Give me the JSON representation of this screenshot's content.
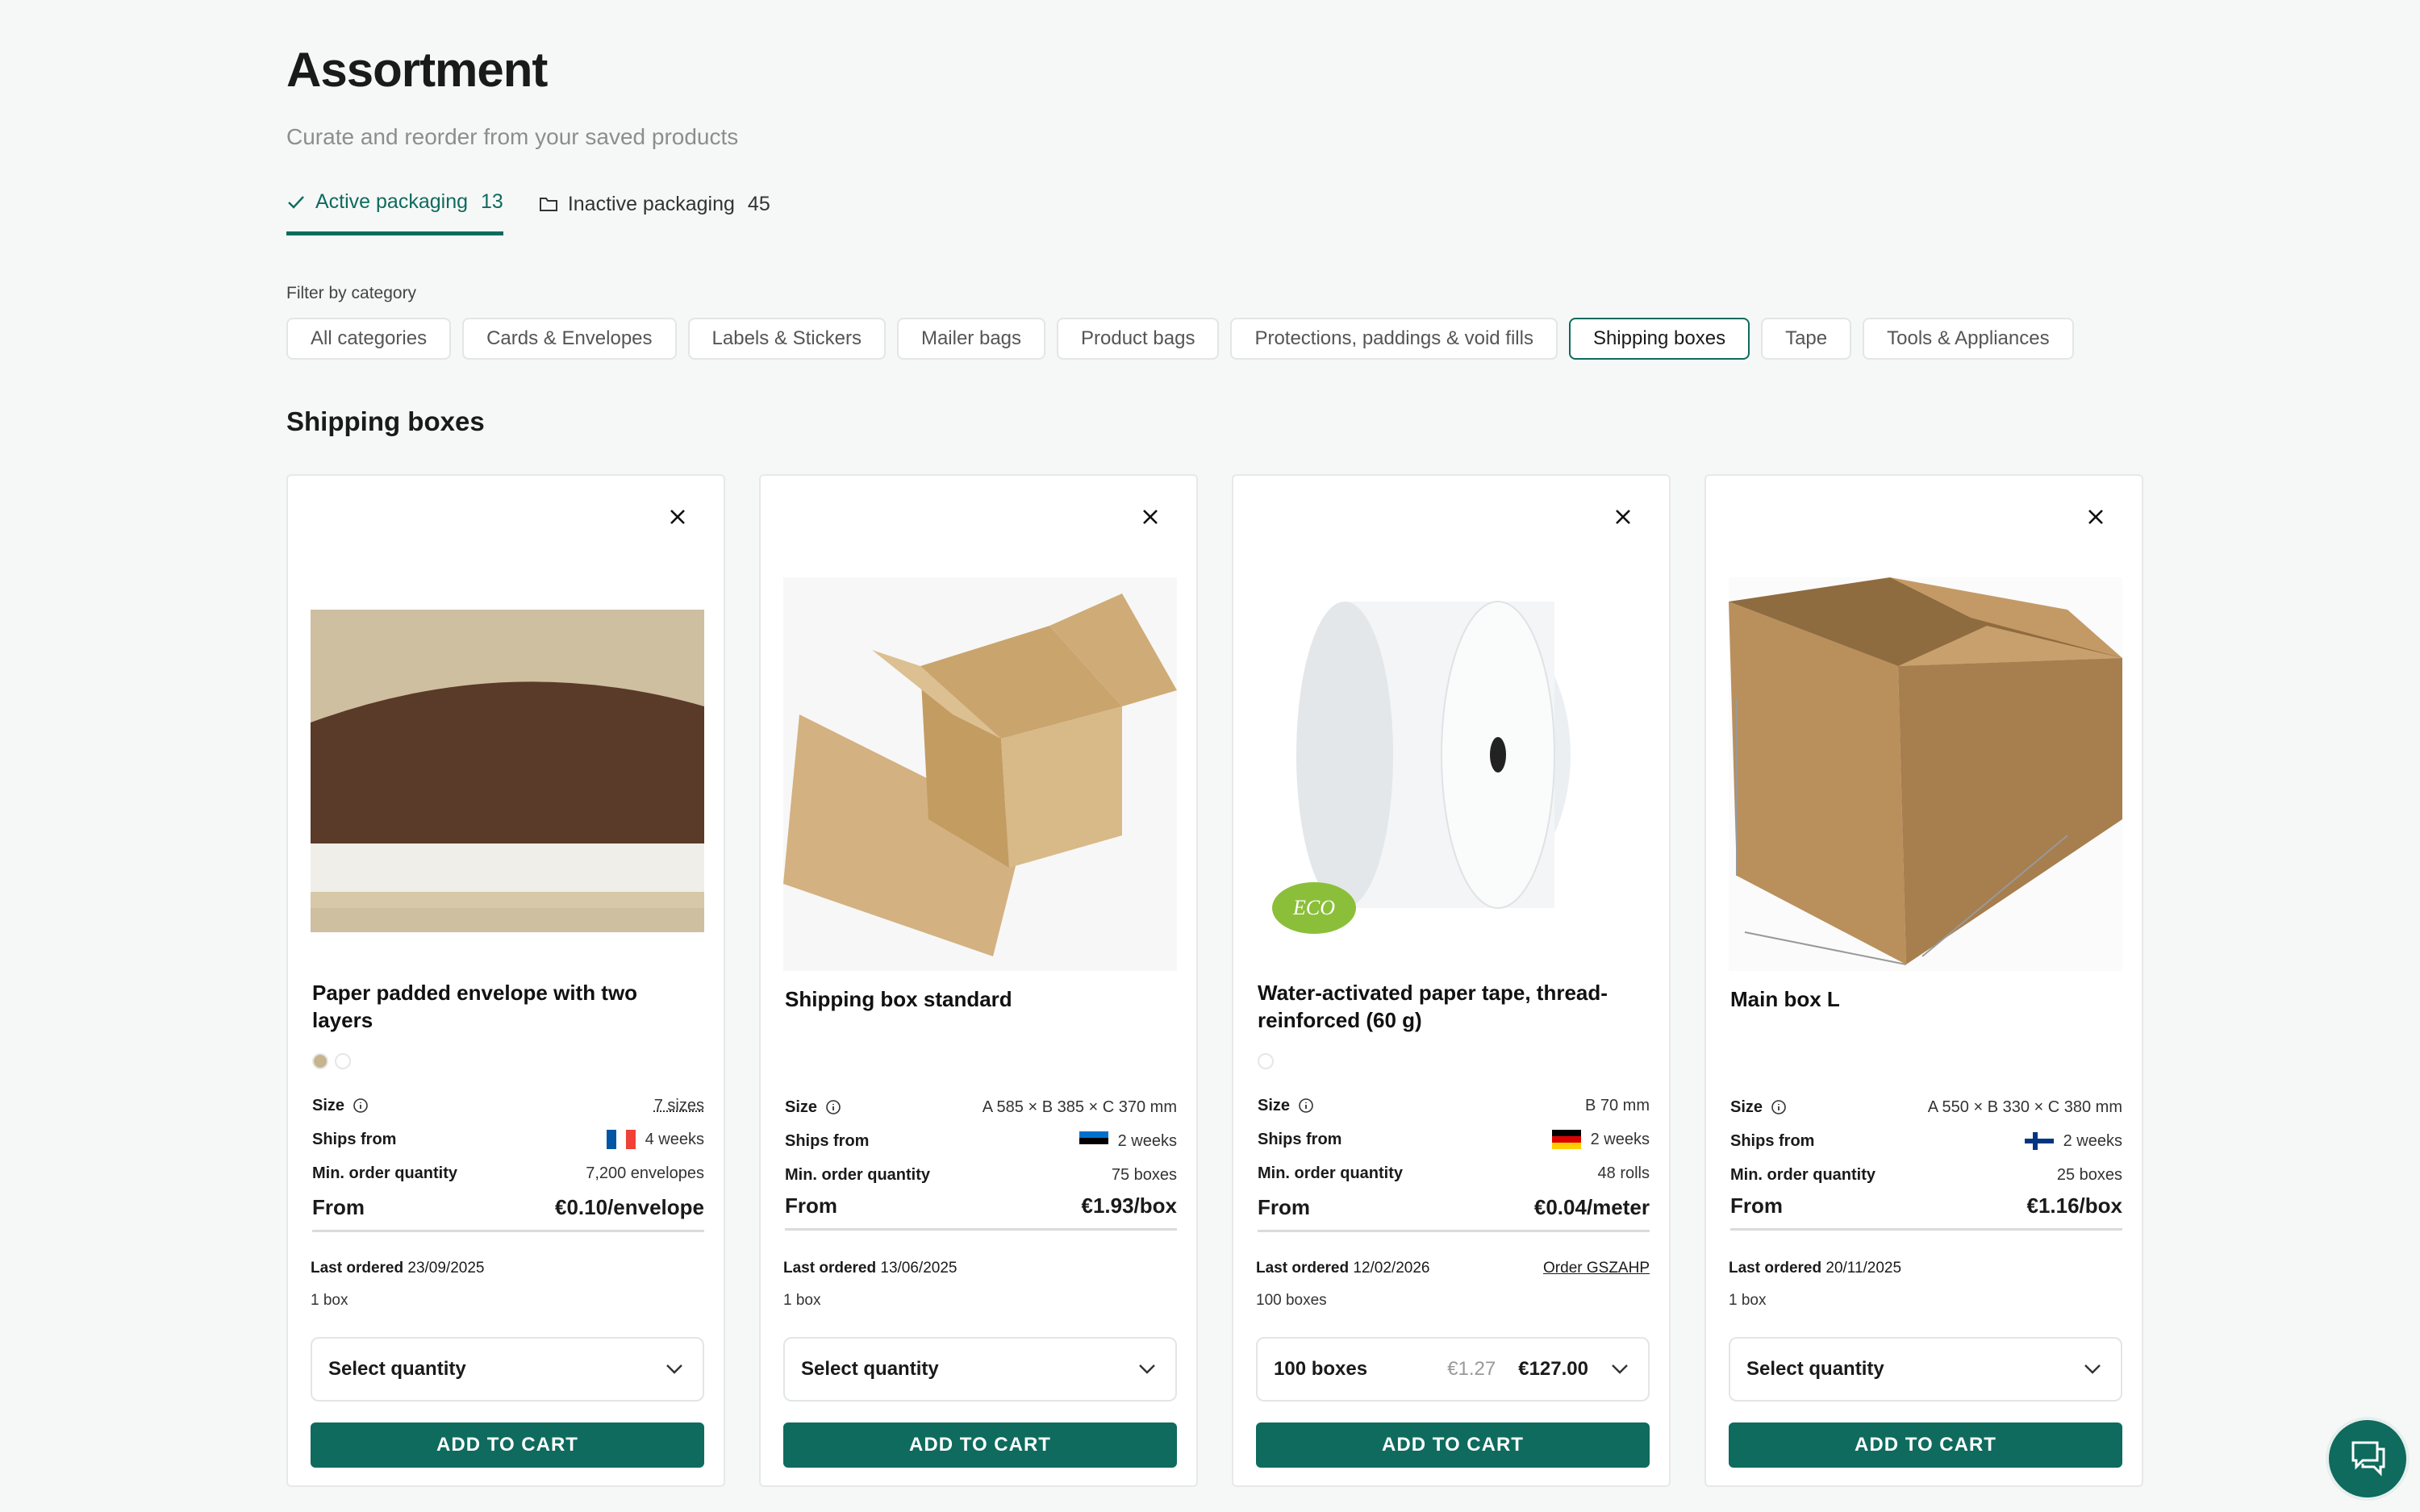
{
  "page": {
    "title": "Assortment",
    "subtitle": "Curate and reorder from your saved products"
  },
  "tabs": [
    {
      "label": "Active packaging",
      "count": "13",
      "icon": "check-icon"
    },
    {
      "label": "Inactive packaging",
      "count": "45",
      "icon": "folder-icon"
    }
  ],
  "filter": {
    "label": "Filter by category",
    "categories": [
      "All categories",
      "Cards & Envelopes",
      "Labels & Stickers",
      "Mailer bags",
      "Product bags",
      "Protections, paddings & void fills",
      "Shipping boxes",
      "Tape",
      "Tools & Appliances"
    ],
    "active": "Shipping boxes"
  },
  "section": {
    "title": "Shipping boxes"
  },
  "labels": {
    "size": "Size",
    "ships_from": "Ships from",
    "min_order": "Min. order quantity",
    "from": "From",
    "last_ordered": "Last ordered",
    "add_to_cart": "ADD TO CART"
  },
  "products": [
    {
      "name": "Paper padded envelope with two layers",
      "size": "7 sizes",
      "ships_from_flag": "France",
      "lead_time": "4 weeks",
      "min_order": "7,200 envelopes",
      "price": "€0.10/envelope",
      "last_ordered_date": "23/09/2025",
      "last_qty": "1 box",
      "select": "Select quantity",
      "swatch_colors": [
        "#c7b48f",
        "#ffffff"
      ]
    },
    {
      "name": "Shipping box standard",
      "size": "A 585 × B 385 × C 370 mm",
      "ships_from_flag": "Estonia",
      "lead_time": "2 weeks",
      "min_order": "75 boxes",
      "price": "€1.93/box",
      "last_ordered_date": "13/06/2025",
      "last_qty": "1 box",
      "select": "Select quantity"
    },
    {
      "name": "Water-activated paper tape, thread-reinforced (60 g)",
      "size": "B 70 mm",
      "ships_from_flag": "Germany",
      "lead_time": "2 weeks",
      "min_order": "48 rolls",
      "price": "€0.04/meter",
      "last_ordered_date": "12/02/2026",
      "order_link": "Order GSZAHP",
      "last_qty": "100 boxes",
      "select_qty": "100 boxes",
      "select_unit": "€1.27",
      "select_total": "€127.00",
      "eco_badge": "ECO",
      "swatch_colors": [
        "#ffffff"
      ]
    },
    {
      "name": "Main box L",
      "size": "A 550 × B 330 × C 380 mm",
      "ships_from_flag": "Finland",
      "lead_time": "2 weeks",
      "min_order": "25 boxes",
      "price": "€1.16/box",
      "last_ordered_date": "20/11/2025",
      "last_qty": "1 box",
      "select": "Select quantity"
    }
  ],
  "colors": {
    "accent": "#0e6b5e",
    "background": "#f6f8f7"
  }
}
